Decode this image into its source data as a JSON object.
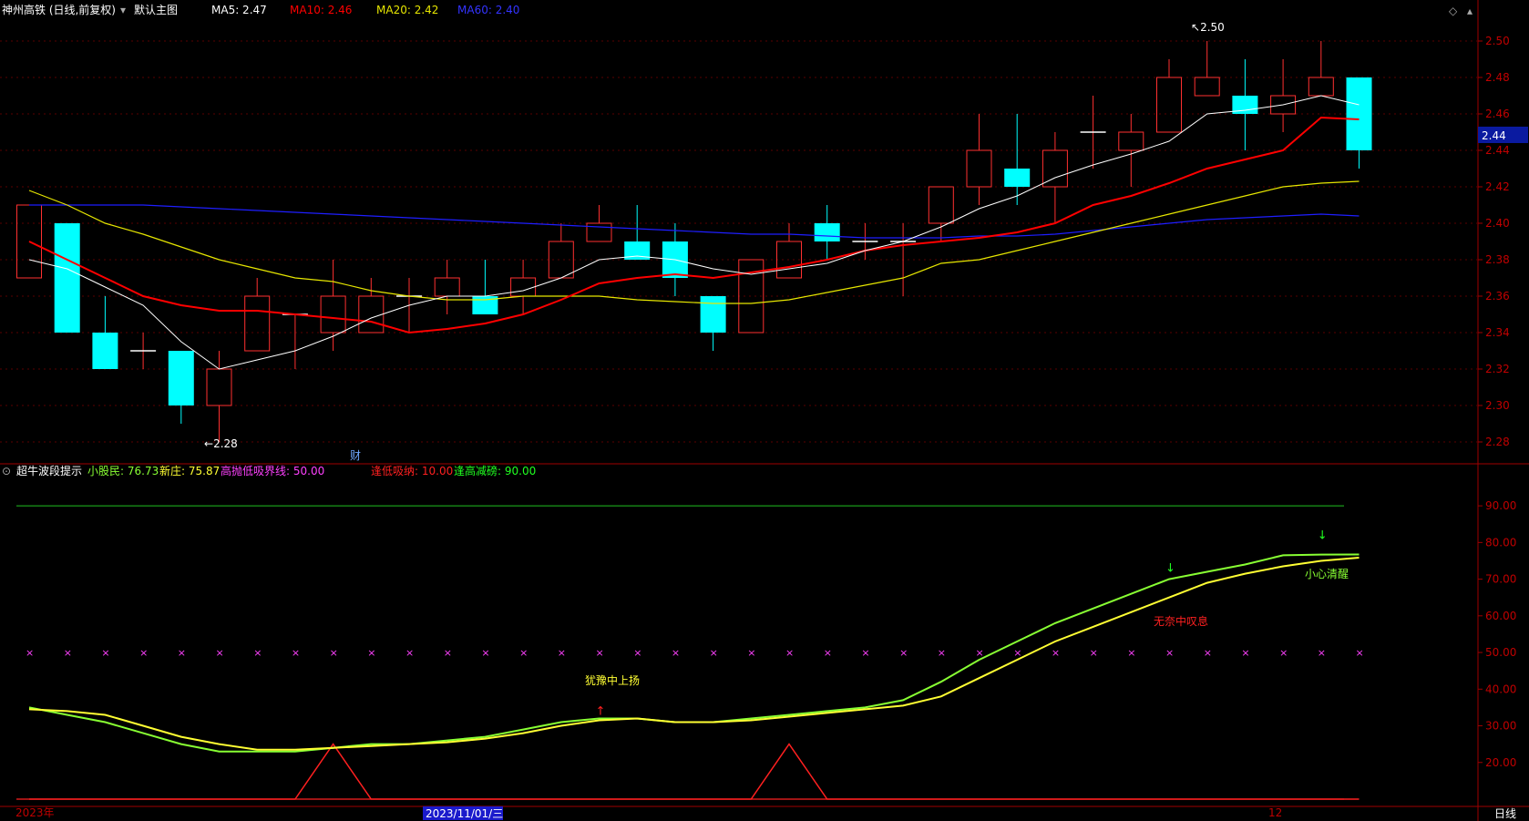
{
  "header": {
    "title": "神州高铁 (日线,前复权)",
    "subchart_name": "默认主图",
    "ma5_label": "MA5: 2.47",
    "ma10_label": "MA10: 2.46",
    "ma20_label": "MA20: 2.42",
    "ma60_label": "MA60: 2.40"
  },
  "indicator_header": {
    "name": "超牛波段提示",
    "xiaogumin": "小股民: 76.73",
    "xinzhuang": "新庄: 75.87",
    "boundary": "高抛低吸界线: 50.00",
    "low_absorb": "逢低吸纳: 10.00",
    "high_reduce": "逢高减磅: 90.00"
  },
  "price_axis": {
    "ticks": [
      "2.50",
      "2.48",
      "2.46",
      "2.44",
      "2.42",
      "2.40",
      "2.38",
      "2.36",
      "2.34",
      "2.32",
      "2.30",
      "2.28"
    ],
    "current_price": "2.44"
  },
  "indicator_axis": {
    "ticks": [
      "90.00",
      "80.00",
      "70.00",
      "60.00",
      "50.00",
      "40.00",
      "30.00",
      "20.00"
    ]
  },
  "annotations": {
    "high_label": "2.50",
    "low_label": "2.28",
    "finance_marker": "财",
    "signal_1": "犹豫中上扬",
    "signal_2": "无奈中叹息",
    "signal_3": "小心清醒"
  },
  "bottom_axis": {
    "year_label": "2023年",
    "cursor_date": "2023/11/01/三",
    "month_label": "12",
    "period": "日线"
  },
  "colors": {
    "up": "#ff3030",
    "down": "#00ffff",
    "ma5": "#ffffff",
    "ma10": "#ff0000",
    "ma20": "#e6e600",
    "ma60": "#1e1eff",
    "indicator_green": "#88ff33",
    "indicator_yellow": "#ffff33",
    "boundary_magenta": "#ff40ff"
  },
  "chart_data": {
    "type": "candlestick",
    "candles": [
      {
        "o": 2.37,
        "c": 2.41,
        "h": 2.41,
        "l": 2.37
      },
      {
        "o": 2.4,
        "c": 2.34,
        "h": 2.4,
        "l": 2.34
      },
      {
        "o": 2.34,
        "c": 2.32,
        "h": 2.36,
        "l": 2.32
      },
      {
        "o": 2.33,
        "c": 2.33,
        "h": 2.34,
        "l": 2.32
      },
      {
        "o": 2.33,
        "c": 2.3,
        "h": 2.33,
        "l": 2.29
      },
      {
        "o": 2.3,
        "c": 2.32,
        "h": 2.33,
        "l": 2.28
      },
      {
        "o": 2.33,
        "c": 2.36,
        "h": 2.37,
        "l": 2.33
      },
      {
        "o": 2.35,
        "c": 2.35,
        "h": 2.35,
        "l": 2.32
      },
      {
        "o": 2.34,
        "c": 2.36,
        "h": 2.38,
        "l": 2.33
      },
      {
        "o": 2.34,
        "c": 2.36,
        "h": 2.37,
        "l": 2.34
      },
      {
        "o": 2.36,
        "c": 2.36,
        "h": 2.37,
        "l": 2.34
      },
      {
        "o": 2.36,
        "c": 2.37,
        "h": 2.38,
        "l": 2.35
      },
      {
        "o": 2.36,
        "c": 2.35,
        "h": 2.38,
        "l": 2.35
      },
      {
        "o": 2.36,
        "c": 2.37,
        "h": 2.38,
        "l": 2.35
      },
      {
        "o": 2.37,
        "c": 2.39,
        "h": 2.4,
        "l": 2.37
      },
      {
        "o": 2.39,
        "c": 2.4,
        "h": 2.41,
        "l": 2.39
      },
      {
        "o": 2.39,
        "c": 2.38,
        "h": 2.41,
        "l": 2.38
      },
      {
        "o": 2.39,
        "c": 2.37,
        "h": 2.4,
        "l": 2.36
      },
      {
        "o": 2.36,
        "c": 2.34,
        "h": 2.36,
        "l": 2.33
      },
      {
        "o": 2.34,
        "c": 2.38,
        "h": 2.38,
        "l": 2.34
      },
      {
        "o": 2.37,
        "c": 2.39,
        "h": 2.4,
        "l": 2.37
      },
      {
        "o": 2.4,
        "c": 2.39,
        "h": 2.41,
        "l": 2.38
      },
      {
        "o": 2.39,
        "c": 2.39,
        "h": 2.4,
        "l": 2.38
      },
      {
        "o": 2.39,
        "c": 2.39,
        "h": 2.4,
        "l": 2.36
      },
      {
        "o": 2.4,
        "c": 2.42,
        "h": 2.42,
        "l": 2.39
      },
      {
        "o": 2.42,
        "c": 2.44,
        "h": 2.46,
        "l": 2.41
      },
      {
        "o": 2.43,
        "c": 2.42,
        "h": 2.46,
        "l": 2.41
      },
      {
        "o": 2.42,
        "c": 2.44,
        "h": 2.45,
        "l": 2.4
      },
      {
        "o": 2.45,
        "c": 2.45,
        "h": 2.47,
        "l": 2.43
      },
      {
        "o": 2.44,
        "c": 2.45,
        "h": 2.46,
        "l": 2.42
      },
      {
        "o": 2.45,
        "c": 2.48,
        "h": 2.49,
        "l": 2.45
      },
      {
        "o": 2.47,
        "c": 2.48,
        "h": 2.5,
        "l": 2.47
      },
      {
        "o": 2.47,
        "c": 2.46,
        "h": 2.49,
        "l": 2.44
      },
      {
        "o": 2.46,
        "c": 2.47,
        "h": 2.49,
        "l": 2.45
      },
      {
        "o": 2.47,
        "c": 2.48,
        "h": 2.5,
        "l": 2.47
      },
      {
        "o": 2.48,
        "c": 2.44,
        "h": 2.48,
        "l": 2.43
      }
    ],
    "ma5": [
      2.38,
      2.375,
      2.365,
      2.355,
      2.335,
      2.32,
      2.325,
      2.33,
      2.338,
      2.348,
      2.355,
      2.36,
      2.36,
      2.363,
      2.37,
      2.38,
      2.382,
      2.38,
      2.375,
      2.372,
      2.375,
      2.378,
      2.385,
      2.39,
      2.398,
      2.408,
      2.415,
      2.425,
      2.432,
      2.438,
      2.445,
      2.46,
      2.462,
      2.465,
      2.47,
      2.465
    ],
    "ma10": [
      2.39,
      2.38,
      2.37,
      2.36,
      2.355,
      2.352,
      2.352,
      2.35,
      2.348,
      2.346,
      2.34,
      2.342,
      2.345,
      2.35,
      2.358,
      2.367,
      2.37,
      2.372,
      2.37,
      2.373,
      2.376,
      2.38,
      2.385,
      2.388,
      2.39,
      2.392,
      2.395,
      2.4,
      2.41,
      2.415,
      2.422,
      2.43,
      2.435,
      2.44,
      2.458,
      2.457
    ],
    "ma20": [
      2.418,
      2.41,
      2.4,
      2.394,
      2.387,
      2.38,
      2.375,
      2.37,
      2.368,
      2.363,
      2.36,
      2.358,
      2.358,
      2.36,
      2.36,
      2.36,
      2.358,
      2.357,
      2.356,
      2.356,
      2.358,
      2.362,
      2.366,
      2.37,
      2.378,
      2.38,
      2.385,
      2.39,
      2.395,
      2.4,
      2.405,
      2.41,
      2.415,
      2.42,
      2.422,
      2.423
    ],
    "ma60": [
      2.41,
      2.41,
      2.41,
      2.41,
      2.409,
      2.408,
      2.407,
      2.406,
      2.405,
      2.404,
      2.403,
      2.402,
      2.401,
      2.4,
      2.399,
      2.398,
      2.397,
      2.396,
      2.395,
      2.394,
      2.394,
      2.393,
      2.392,
      2.392,
      2.392,
      2.393,
      2.393,
      2.394,
      2.396,
      2.398,
      2.4,
      2.402,
      2.403,
      2.404,
      2.405,
      2.404
    ],
    "xiaogumin": [
      35,
      33,
      31,
      28,
      25,
      23,
      23,
      23,
      24,
      25,
      25,
      26,
      27,
      29,
      31,
      32,
      32,
      31,
      31,
      32,
      33,
      34,
      35,
      37,
      42,
      48,
      53,
      58,
      62,
      66,
      70,
      72,
      74,
      76.5,
      76.7,
      76.73
    ],
    "xinzhuang": [
      34.5,
      34,
      33,
      30,
      27,
      25,
      23.5,
      23.5,
      24,
      24.5,
      25,
      25.5,
      26.5,
      28,
      30,
      31.5,
      32,
      31,
      31,
      31.5,
      32.5,
      33.5,
      34.5,
      35.5,
      38,
      43,
      48,
      53,
      57,
      61,
      65,
      69,
      71.5,
      73.5,
      75,
      75.87
    ],
    "boundary": 50,
    "signal": [
      10,
      10,
      10,
      10,
      10,
      10,
      10,
      10,
      25,
      10,
      10,
      10,
      10,
      10,
      10,
      10,
      10,
      10,
      10,
      10,
      25,
      10,
      10,
      10,
      10,
      10,
      10,
      10,
      10,
      10,
      10,
      10,
      10,
      10,
      10,
      10
    ],
    "price_range": [
      2.27,
      2.51
    ],
    "indicator_range": [
      10,
      95
    ]
  }
}
